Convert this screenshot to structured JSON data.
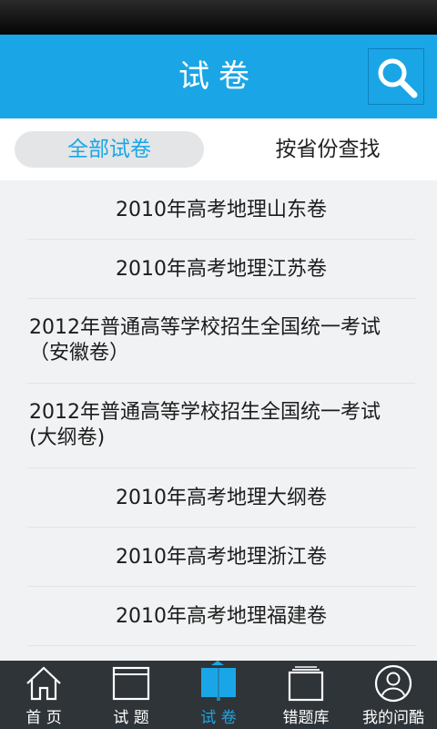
{
  "header": {
    "title": "试卷"
  },
  "filters": {
    "all_label": "全部试卷",
    "province_label": "按省份查找"
  },
  "papers": [
    "2010年高考地理山东卷",
    "2010年高考地理江苏卷",
    "2012年普通高等学校招生全国统一考试（安徽卷）",
    "2012年普通高等学校招生全国统一考试(大纲卷)",
    "2010年高考地理大纲卷",
    "2010年高考地理浙江卷",
    "2010年高考地理福建卷"
  ],
  "tabbar": {
    "home": "首 页",
    "questions": "试 题",
    "papers": "试 卷",
    "mistakes": "错题库",
    "profile": "我的问酷"
  },
  "colors": {
    "accent": "#1aa6e6",
    "tabbar_bg": "#2f3438",
    "status_bar": "#0a0a0a"
  },
  "icons": {
    "search": "search-icon",
    "home": "home-icon",
    "questions": "questions-icon",
    "papers": "book-icon",
    "mistakes": "folder-icon",
    "profile": "user-icon"
  }
}
